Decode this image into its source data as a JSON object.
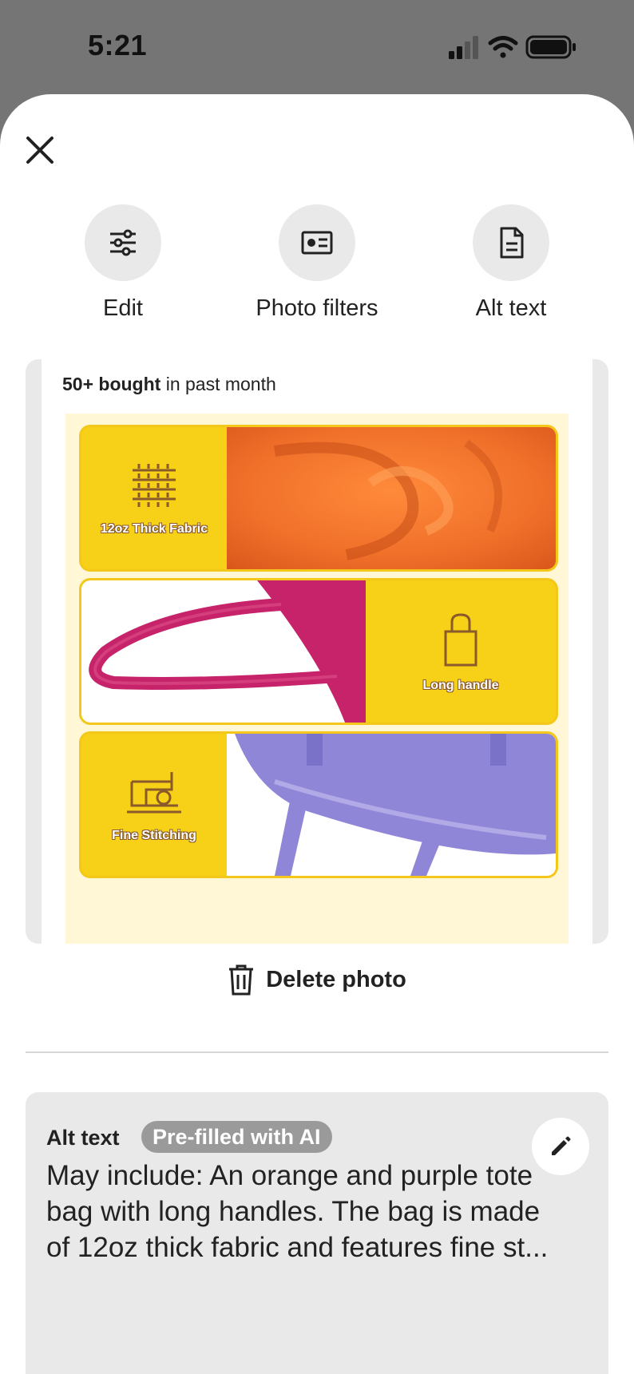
{
  "status_bar": {
    "time": "5:21",
    "icons": [
      "cellular-signal-icon",
      "wifi-icon",
      "battery-icon"
    ]
  },
  "toolbar": {
    "items": [
      {
        "label": "Edit",
        "icon": "sliders-icon"
      },
      {
        "label": "Photo filters",
        "icon": "photo-filter-icon"
      },
      {
        "label": "Alt text",
        "icon": "document-icon"
      }
    ]
  },
  "photo": {
    "badge_bold": "50+ bought",
    "badge_rest": " in past month",
    "features": [
      {
        "label": "12oz Thick Fabric",
        "icon": "fabric-weave-icon"
      },
      {
        "label": "Long handle",
        "icon": "bag-handle-icon"
      },
      {
        "label": "Fine Stitching",
        "icon": "sewing-machine-icon"
      }
    ]
  },
  "actions": {
    "delete_label": "Delete photo"
  },
  "alt_text": {
    "title": "Alt text",
    "badge": "Pre-filled with AI",
    "description": "May include: An orange and purple tote bag with long handles. The bag is made of 12oz thick fabric and features fine st..."
  },
  "colors": {
    "accent_yellow": "#f7d117",
    "fabric_orange": "#f0702a",
    "bag_magenta": "#c6236a",
    "bag_purple": "#8f86d8",
    "chip_bg": "#e9e9e9",
    "badge_bg": "#9a9a9a"
  }
}
